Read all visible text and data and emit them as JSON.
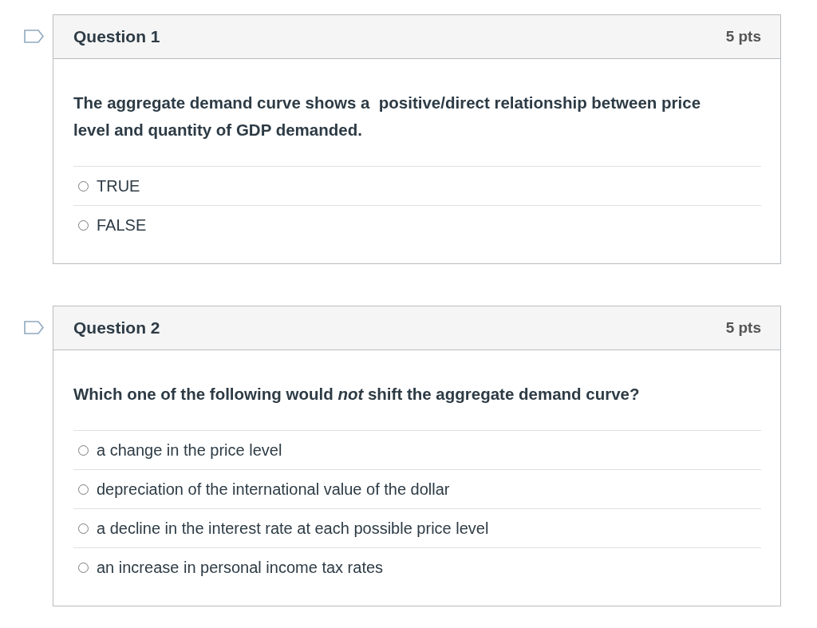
{
  "questions": [
    {
      "title": "Question 1",
      "points": "5 pts",
      "text": "The aggregate demand curve shows a  positive/direct relationship between price level and quantity of GDP demanded.",
      "answers": [
        {
          "label": "TRUE",
          "selected": false
        },
        {
          "label": "FALSE",
          "selected": false
        }
      ]
    },
    {
      "title": "Question 2",
      "points": "5 pts",
      "text": "Which one of the following would *not* shift the aggregate demand curve?",
      "answers": [
        {
          "label": "a change in the price level",
          "selected": false
        },
        {
          "label": "depreciation of the international value of the dollar",
          "selected": false
        },
        {
          "label": "a decline in the interest rate at each possible price level",
          "selected": false
        },
        {
          "label": "an increase in personal income tax rates",
          "selected": false
        }
      ]
    }
  ]
}
